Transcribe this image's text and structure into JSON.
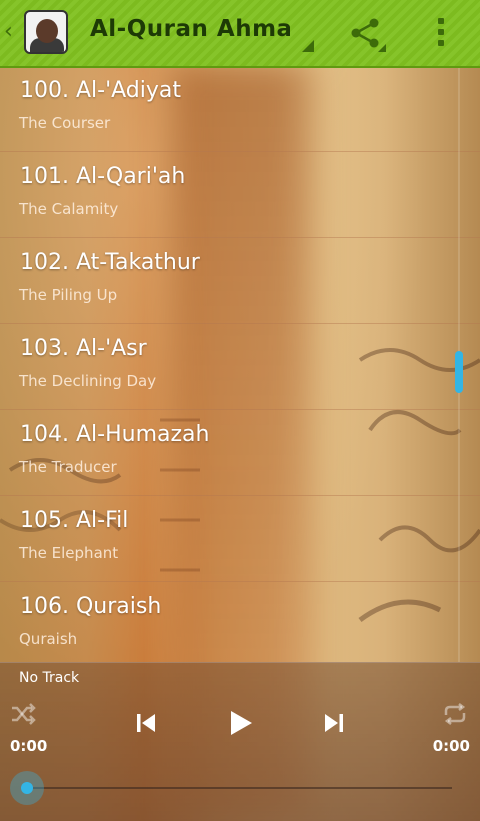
{
  "app_bar": {
    "title": "Al-Quran Ahmad Sa..",
    "icons": [
      "back-icon",
      "app-icon",
      "share-icon",
      "overflow-menu-icon"
    ]
  },
  "surahs": [
    {
      "name": "100. Al-'Adiyat",
      "translation": "The Courser"
    },
    {
      "name": "101. Al-Qari'ah",
      "translation": "The Calamity"
    },
    {
      "name": "102. At-Takathur",
      "translation": "The Piling Up"
    },
    {
      "name": "103. Al-'Asr",
      "translation": "The Declining Day"
    },
    {
      "name": "104. Al-Humazah",
      "translation": "The Traducer"
    },
    {
      "name": "105. Al-Fil",
      "translation": "The Elephant"
    },
    {
      "name": "106. Quraish",
      "translation": "Quraish"
    }
  ],
  "player": {
    "track": "No Track",
    "elapsed": "0:00",
    "duration": "0:00",
    "progress": 0,
    "icons": [
      "shuffle-icon",
      "previous-icon",
      "play-icon",
      "next-icon",
      "repeat-icon"
    ]
  },
  "colors": {
    "action_bar": "#7dbb1f",
    "accent": "#33b5e5"
  }
}
